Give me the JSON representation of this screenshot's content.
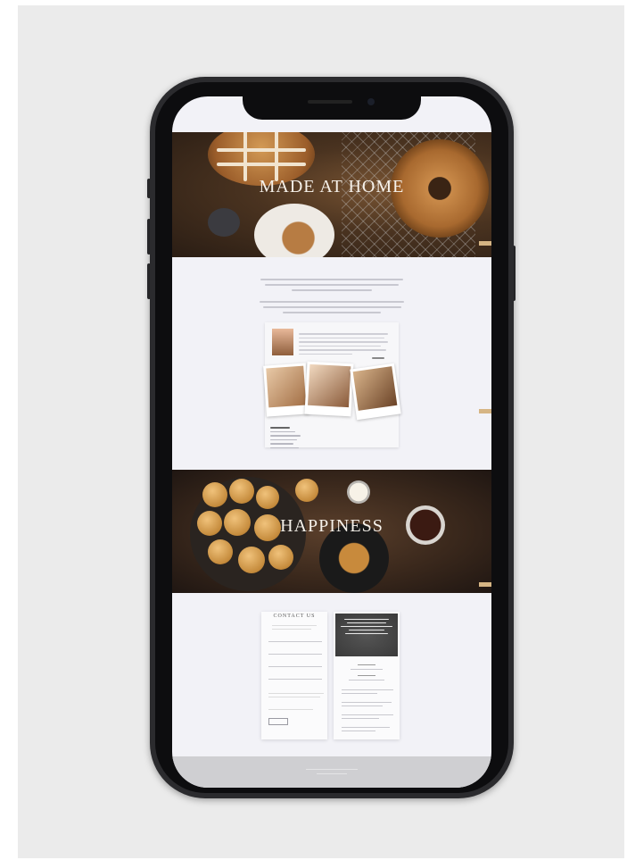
{
  "hero": {
    "title": "MADE AT HOME",
    "subtitle": ""
  },
  "section2": {
    "title": "HAPPINESS",
    "subtitle": ""
  },
  "contact": {
    "title": "CONTACT US"
  },
  "colors": {
    "frame": "#2b2b2e",
    "backdrop": "#ebebeb",
    "screen": "#f2f2f7",
    "accent": "#d6b584"
  },
  "icons": [
    "phone-frame",
    "front-camera",
    "speaker"
  ]
}
